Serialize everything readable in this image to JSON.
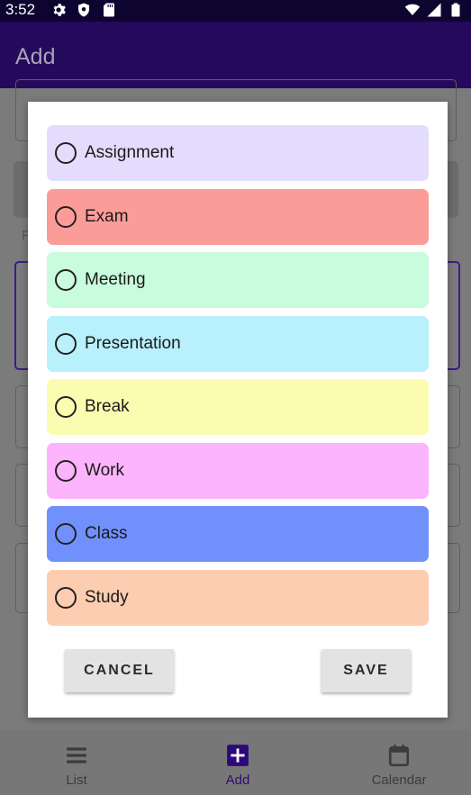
{
  "status_bar": {
    "time": "3:52",
    "left_icons": [
      "gear-icon",
      "shield-icon",
      "sd-card-icon"
    ],
    "right_icons": [
      "wifi-icon",
      "cell-signal-icon",
      "battery-icon"
    ]
  },
  "app_bar": {
    "title": "Add"
  },
  "dialog": {
    "options": [
      {
        "label": "Assignment",
        "color": "#e4dcfc"
      },
      {
        "label": "Exam",
        "color": "#fc9c98"
      },
      {
        "label": "Meeting",
        "color": "#c8fcdc"
      },
      {
        "label": "Presentation",
        "color": "#b8f0fc"
      },
      {
        "label": "Break",
        "color": "#fcfcb0"
      },
      {
        "label": "Work",
        "color": "#fcb4fc"
      },
      {
        "label": "Class",
        "color": "#7090fc"
      },
      {
        "label": "Study",
        "color": "#fccdb0"
      }
    ],
    "cancel_label": "CANCEL",
    "save_label": "SAVE"
  },
  "bottom_nav": {
    "items": [
      {
        "label": "List",
        "icon": "list-icon"
      },
      {
        "label": "Add",
        "icon": "add-box-icon",
        "active": true
      },
      {
        "label": "Calendar",
        "icon": "calendar-icon"
      }
    ]
  },
  "background_form": {
    "label_fragment": "P"
  }
}
